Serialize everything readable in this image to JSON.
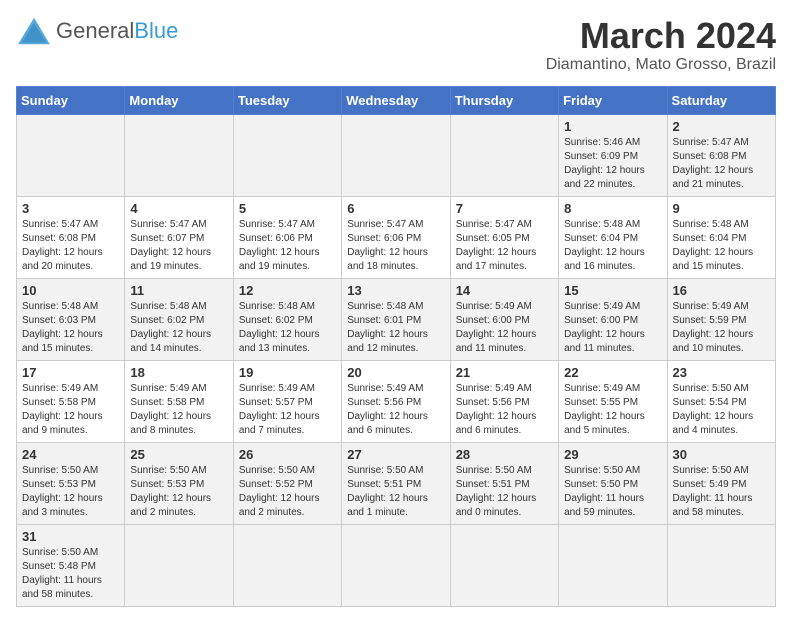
{
  "header": {
    "logo_general": "General",
    "logo_blue": "Blue",
    "month_title": "March 2024",
    "location": "Diamantino, Mato Grosso, Brazil"
  },
  "weekdays": [
    "Sunday",
    "Monday",
    "Tuesday",
    "Wednesday",
    "Thursday",
    "Friday",
    "Saturday"
  ],
  "weeks": [
    [
      {
        "day": "",
        "info": ""
      },
      {
        "day": "",
        "info": ""
      },
      {
        "day": "",
        "info": ""
      },
      {
        "day": "",
        "info": ""
      },
      {
        "day": "",
        "info": ""
      },
      {
        "day": "1",
        "info": "Sunrise: 5:46 AM\nSunset: 6:09 PM\nDaylight: 12 hours\nand 22 minutes."
      },
      {
        "day": "2",
        "info": "Sunrise: 5:47 AM\nSunset: 6:08 PM\nDaylight: 12 hours\nand 21 minutes."
      }
    ],
    [
      {
        "day": "3",
        "info": "Sunrise: 5:47 AM\nSunset: 6:08 PM\nDaylight: 12 hours\nand 20 minutes."
      },
      {
        "day": "4",
        "info": "Sunrise: 5:47 AM\nSunset: 6:07 PM\nDaylight: 12 hours\nand 19 minutes."
      },
      {
        "day": "5",
        "info": "Sunrise: 5:47 AM\nSunset: 6:06 PM\nDaylight: 12 hours\nand 19 minutes."
      },
      {
        "day": "6",
        "info": "Sunrise: 5:47 AM\nSunset: 6:06 PM\nDaylight: 12 hours\nand 18 minutes."
      },
      {
        "day": "7",
        "info": "Sunrise: 5:47 AM\nSunset: 6:05 PM\nDaylight: 12 hours\nand 17 minutes."
      },
      {
        "day": "8",
        "info": "Sunrise: 5:48 AM\nSunset: 6:04 PM\nDaylight: 12 hours\nand 16 minutes."
      },
      {
        "day": "9",
        "info": "Sunrise: 5:48 AM\nSunset: 6:04 PM\nDaylight: 12 hours\nand 15 minutes."
      }
    ],
    [
      {
        "day": "10",
        "info": "Sunrise: 5:48 AM\nSunset: 6:03 PM\nDaylight: 12 hours\nand 15 minutes."
      },
      {
        "day": "11",
        "info": "Sunrise: 5:48 AM\nSunset: 6:02 PM\nDaylight: 12 hours\nand 14 minutes."
      },
      {
        "day": "12",
        "info": "Sunrise: 5:48 AM\nSunset: 6:02 PM\nDaylight: 12 hours\nand 13 minutes."
      },
      {
        "day": "13",
        "info": "Sunrise: 5:48 AM\nSunset: 6:01 PM\nDaylight: 12 hours\nand 12 minutes."
      },
      {
        "day": "14",
        "info": "Sunrise: 5:49 AM\nSunset: 6:00 PM\nDaylight: 12 hours\nand 11 minutes."
      },
      {
        "day": "15",
        "info": "Sunrise: 5:49 AM\nSunset: 6:00 PM\nDaylight: 12 hours\nand 11 minutes."
      },
      {
        "day": "16",
        "info": "Sunrise: 5:49 AM\nSunset: 5:59 PM\nDaylight: 12 hours\nand 10 minutes."
      }
    ],
    [
      {
        "day": "17",
        "info": "Sunrise: 5:49 AM\nSunset: 5:58 PM\nDaylight: 12 hours\nand 9 minutes."
      },
      {
        "day": "18",
        "info": "Sunrise: 5:49 AM\nSunset: 5:58 PM\nDaylight: 12 hours\nand 8 minutes."
      },
      {
        "day": "19",
        "info": "Sunrise: 5:49 AM\nSunset: 5:57 PM\nDaylight: 12 hours\nand 7 minutes."
      },
      {
        "day": "20",
        "info": "Sunrise: 5:49 AM\nSunset: 5:56 PM\nDaylight: 12 hours\nand 6 minutes."
      },
      {
        "day": "21",
        "info": "Sunrise: 5:49 AM\nSunset: 5:56 PM\nDaylight: 12 hours\nand 6 minutes."
      },
      {
        "day": "22",
        "info": "Sunrise: 5:49 AM\nSunset: 5:55 PM\nDaylight: 12 hours\nand 5 minutes."
      },
      {
        "day": "23",
        "info": "Sunrise: 5:50 AM\nSunset: 5:54 PM\nDaylight: 12 hours\nand 4 minutes."
      }
    ],
    [
      {
        "day": "24",
        "info": "Sunrise: 5:50 AM\nSunset: 5:53 PM\nDaylight: 12 hours\nand 3 minutes."
      },
      {
        "day": "25",
        "info": "Sunrise: 5:50 AM\nSunset: 5:53 PM\nDaylight: 12 hours\nand 2 minutes."
      },
      {
        "day": "26",
        "info": "Sunrise: 5:50 AM\nSunset: 5:52 PM\nDaylight: 12 hours\nand 2 minutes."
      },
      {
        "day": "27",
        "info": "Sunrise: 5:50 AM\nSunset: 5:51 PM\nDaylight: 12 hours\nand 1 minute."
      },
      {
        "day": "28",
        "info": "Sunrise: 5:50 AM\nSunset: 5:51 PM\nDaylight: 12 hours\nand 0 minutes."
      },
      {
        "day": "29",
        "info": "Sunrise: 5:50 AM\nSunset: 5:50 PM\nDaylight: 11 hours\nand 59 minutes."
      },
      {
        "day": "30",
        "info": "Sunrise: 5:50 AM\nSunset: 5:49 PM\nDaylight: 11 hours\nand 58 minutes."
      }
    ],
    [
      {
        "day": "31",
        "info": "Sunrise: 5:50 AM\nSunset: 5:48 PM\nDaylight: 11 hours\nand 58 minutes."
      },
      {
        "day": "",
        "info": ""
      },
      {
        "day": "",
        "info": ""
      },
      {
        "day": "",
        "info": ""
      },
      {
        "day": "",
        "info": ""
      },
      {
        "day": "",
        "info": ""
      },
      {
        "day": "",
        "info": ""
      }
    ]
  ]
}
